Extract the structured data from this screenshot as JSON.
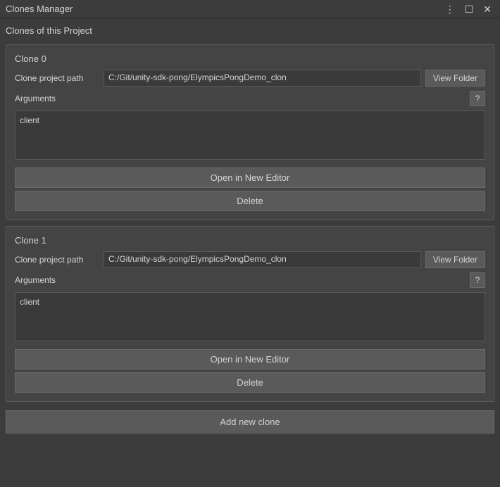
{
  "titleBar": {
    "title": "Clones Manager",
    "menuIcon": "⋮",
    "maximizeIcon": "☐",
    "closeIcon": "✕"
  },
  "pageTitle": "Clones of this Project",
  "clones": [
    {
      "name": "Clone 0",
      "pathLabel": "Clone project path",
      "path": "C:/Git/unity-sdk-pong/ElympicsPongDemo_clon",
      "viewFolderLabel": "View Folder",
      "argumentsLabel": "Arguments",
      "helpLabel": "?",
      "argumentsValue": "client",
      "openEditorLabel": "Open in New Editor",
      "deleteLabel": "Delete"
    },
    {
      "name": "Clone 1",
      "pathLabel": "Clone project path",
      "path": "C:/Git/unity-sdk-pong/ElympicsPongDemo_clon",
      "viewFolderLabel": "View Folder",
      "argumentsLabel": "Arguments",
      "helpLabel": "?",
      "argumentsValue": "client",
      "openEditorLabel": "Open in New Editor",
      "deleteLabel": "Delete"
    }
  ],
  "addCloneLabel": "Add new clone"
}
